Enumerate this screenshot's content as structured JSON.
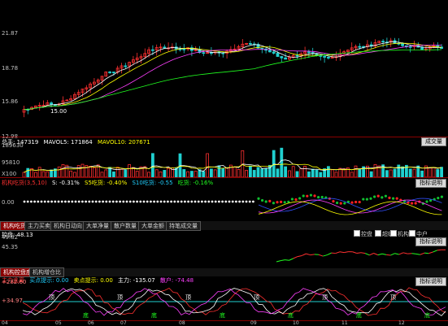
{
  "price_panel": {
    "y_labels": [
      "21.87",
      "18.78",
      "15.86",
      "12.98"
    ],
    "low_marker": "15.00"
  },
  "volume_panel": {
    "info": [
      "总手: 147319",
      "MAVOL5: 171864",
      "MAVOL10: 207671"
    ],
    "button": "成交量",
    "y_labels": [
      "189630",
      "95810",
      "X100"
    ]
  },
  "ind1_panel": {
    "info": [
      "机构吃货(3,5,10)",
      "S: -0.31%",
      "S5吃货: -0.40%",
      "S10吃货: -0.55",
      "吃货: -0.16%"
    ],
    "button": "指标说明",
    "y_label": "0.00",
    "colors": {
      "red": "#ff2020",
      "green": "#10c030",
      "blue": "#3050ff",
      "white": "#ffffff"
    }
  },
  "tabs": {
    "items": [
      "机构吃货",
      "主力买卖",
      "机构日动向",
      "大单净量",
      "散户数量",
      "大单金额",
      "持笔成交量"
    ],
    "active": 0
  },
  "control_panel": {
    "info": "控盘: 48.13",
    "y_labels": [
      "49.82",
      "45.35"
    ],
    "legend": [
      "控盘",
      "超级",
      "机构",
      "中户"
    ],
    "button": "指标说明"
  },
  "tabs2": {
    "items": [
      "机构控盘度",
      "机构增仓比"
    ],
    "active": 0
  },
  "main_force_panel": {
    "info": [
      "主力逃离",
      "买点提示: 0.00",
      "卖点提示: 0.00",
      "主力: -135.07",
      "散户: -74.48"
    ],
    "button": "指标说明",
    "y_labels": [
      "+282.60",
      "+34.97"
    ],
    "markers": [
      "顶",
      "底"
    ]
  },
  "x_axis": {
    "labels": [
      "04",
      "05",
      "06",
      "07",
      "08",
      "09",
      "10",
      "11",
      "12"
    ]
  }
}
